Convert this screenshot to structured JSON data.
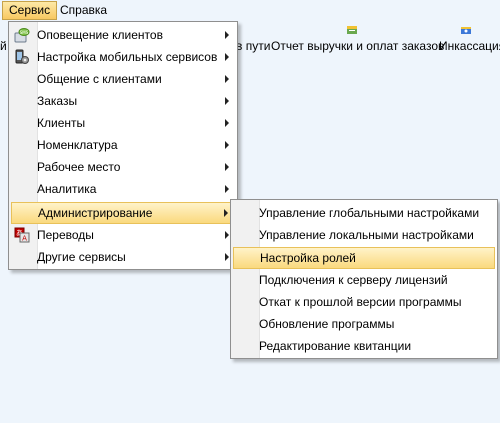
{
  "menubar": {
    "items": [
      {
        "label": "Сервис"
      },
      {
        "label": "Справка"
      }
    ]
  },
  "toolbar": {
    "partial_label": "й",
    "in_transit_label": "в пути",
    "revenue_report_label": "Отчет выручки и оплат заказов",
    "collection_label": "Инкассация"
  },
  "service_menu": {
    "items": [
      {
        "label": "Оповещение клиентов",
        "icon": "sms-notify-icon"
      },
      {
        "label": "Настройка мобильных сервисов",
        "icon": "mobile-gear-icon"
      },
      {
        "label": "Общение с клиентами"
      },
      {
        "label": "Заказы"
      },
      {
        "label": "Клиенты"
      },
      {
        "label": "Номенклатура"
      },
      {
        "label": "Рабочее место"
      },
      {
        "label": "Аналитика"
      },
      {
        "label": "Администрирование",
        "highlighted": true
      },
      {
        "label": "Переводы",
        "icon": "translate-icon"
      },
      {
        "label": "Другие сервисы"
      }
    ]
  },
  "admin_submenu": {
    "items": [
      {
        "label": "Управление глобальными настройками"
      },
      {
        "label": "Управление локальными настройками"
      },
      {
        "label": "Настройка ролей",
        "highlighted": true
      },
      {
        "label": "Подключения к серверу лицензий"
      },
      {
        "label": "Откат к прошлой версии программы"
      },
      {
        "label": "Обновление программы"
      },
      {
        "label": "Редактирование квитанции"
      }
    ]
  },
  "colors": {
    "background": "#eef5fc",
    "highlight_top": "#fff3c9",
    "highlight_bottom": "#fad97e",
    "highlight_border": "#e8c15a"
  }
}
